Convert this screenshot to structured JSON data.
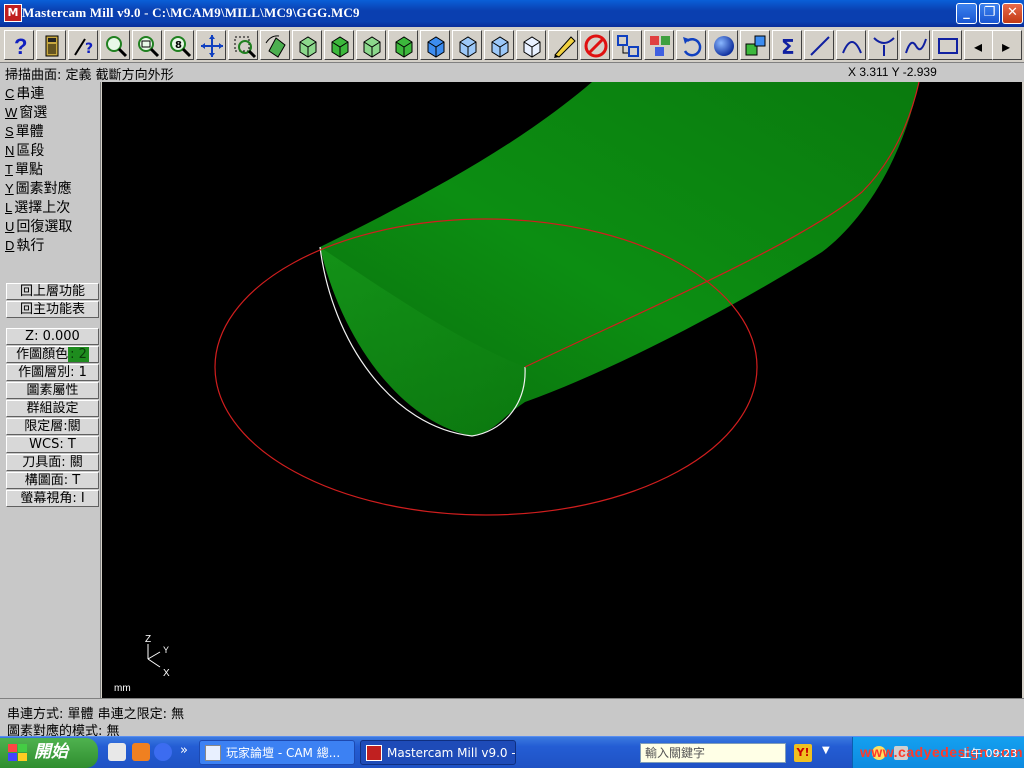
{
  "window": {
    "title": "Mastercam Mill v9.0 - C:\\MCAM9\\MILL\\MC9\\GGG.MC9",
    "icon_label": "M",
    "min_glyph": "_",
    "max_glyph": "❐",
    "close_glyph": "✕"
  },
  "toolbar": {
    "buttons": [
      {
        "name": "help-icon"
      },
      {
        "name": "calculator-icon"
      },
      {
        "name": "analyze-icon"
      },
      {
        "name": "zoom-window-icon"
      },
      {
        "name": "unzoom-icon"
      },
      {
        "name": "zoom-fit-icon"
      },
      {
        "name": "pan-icon"
      },
      {
        "name": "select-icon"
      },
      {
        "name": "rotate-view-icon"
      },
      {
        "name": "view-top-icon"
      },
      {
        "name": "view-front-icon"
      },
      {
        "name": "view-side-icon"
      },
      {
        "name": "view-iso-icon"
      },
      {
        "name": "cplane-top-icon"
      },
      {
        "name": "cplane-front-icon"
      },
      {
        "name": "cplane-side-icon"
      },
      {
        "name": "cplane-3d-icon"
      },
      {
        "name": "pencil-icon"
      },
      {
        "name": "delete-icon"
      },
      {
        "name": "translate-icon"
      },
      {
        "name": "copy-icon"
      },
      {
        "name": "undo-icon"
      },
      {
        "name": "shade-sphere-icon"
      },
      {
        "name": "transform-icon"
      },
      {
        "name": "sigma-icon"
      },
      {
        "name": "line-icon"
      },
      {
        "name": "arc-icon"
      },
      {
        "name": "fillet-icon"
      },
      {
        "name": "spline-icon"
      },
      {
        "name": "rectangle-icon"
      },
      {
        "name": "arrow-left-icon"
      },
      {
        "name": "arrow-right-icon"
      }
    ],
    "help_glyph": "?",
    "sigma_glyph": "Σ",
    "left_glyph": "◂",
    "right_glyph": "▸"
  },
  "prompt": {
    "text": "掃描曲面: 定義 截斷方向外形",
    "coords": "X 3.311  Y -2.939"
  },
  "menu": {
    "items": [
      {
        "key": "C",
        "label": "串連"
      },
      {
        "key": "W",
        "label": "窗選"
      },
      {
        "key": "S",
        "label": "單體"
      },
      {
        "key": "N",
        "label": "區段"
      },
      {
        "key": "T",
        "label": "單點"
      },
      {
        "key": "Y",
        "label": "圖素對應"
      },
      {
        "key": "L",
        "label": "選擇上次"
      },
      {
        "key": "U",
        "label": "回復選取"
      },
      {
        "key": "D",
        "label": "執行"
      }
    ],
    "back_up": "回上層功能",
    "main_menu": "回主功能表",
    "z_depth": "Z:  0.000",
    "color_label": "作圖顏色",
    "color_value": ": 2",
    "level": "作圖層別: 1",
    "attributes": "圖素屬性",
    "groups": "群組設定",
    "mask": "限定層:關",
    "wcs": "WCS:  T",
    "tplane": "刀具面: 關",
    "cplane": "構圖面: T",
    "gview": "螢幕視角: I"
  },
  "viewport": {
    "axis_z": "Z",
    "axis_y": "Y",
    "axis_x": "X",
    "unit": "mm",
    "surface_color": "#0b8a10",
    "curve_color": "#d01e1e"
  },
  "status": {
    "line1": "串連方式: 單體      串連之限定: 無",
    "line2": "圖素對應的模式: 無"
  },
  "taskbar": {
    "start_label": "開始",
    "more_glyph": "»",
    "task_forum": "玩家論壇 - CAM 總...",
    "task_mastercam": "Mastercam Mill v9.0 - ...",
    "search_placeholder": "輸入關鍵字",
    "watermark": "www.cadyedesign.com",
    "time": "上午 09:23"
  }
}
